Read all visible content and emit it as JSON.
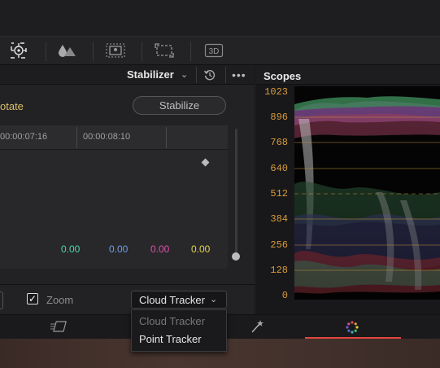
{
  "toolbar": {
    "icons": [
      "target-icon",
      "droplet-icon",
      "image-icon",
      "crop-icon",
      "3d-icon"
    ],
    "three_d_label": "3D"
  },
  "left_panel": {
    "title": "Stabilizer",
    "more_label": "•••",
    "rotate_label": "otate",
    "stabilize_button": "Stabilize",
    "timecodes": [
      "00:00:07:16",
      "00:00:08:10"
    ],
    "values": [
      {
        "text": "0.00",
        "color": "#4fd6a7"
      },
      {
        "text": "0.00",
        "color": "#6f9fe6"
      },
      {
        "text": "0.00",
        "color": "#e04fa7"
      },
      {
        "text": "0.00",
        "color": "#e3d44f"
      }
    ],
    "zoom_label": "Zoom",
    "zoom_checked": true,
    "tracker_selected": "Cloud Tracker",
    "tracker_options": [
      "Cloud Tracker",
      "Point Tracker"
    ]
  },
  "scopes": {
    "title": "Scopes",
    "y_labels": [
      "1023",
      "896",
      "768",
      "640",
      "512",
      "384",
      "256",
      "128",
      "0"
    ],
    "label_color": "#d99b3a"
  },
  "bottom_nav": {
    "items": [
      "tracker-icon",
      "magic-wand-icon",
      "color-wheel-icon"
    ],
    "active_color": "#e0463a"
  }
}
